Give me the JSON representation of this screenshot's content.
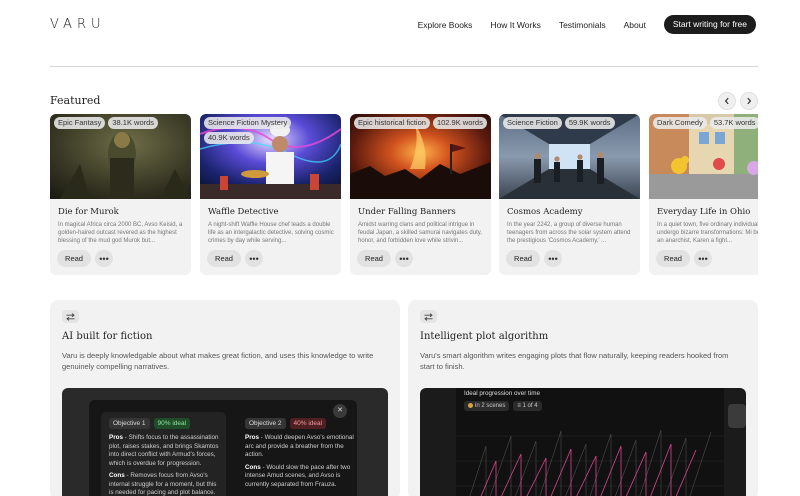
{
  "brand": {
    "logo": "VARU"
  },
  "nav": {
    "links": [
      "Explore Books",
      "How It Works",
      "Testimonials",
      "About"
    ],
    "cta": "Start writing for free"
  },
  "featured": {
    "title": "Featured",
    "read_label": "Read",
    "books": [
      {
        "title": "Die for Murok",
        "tags": [
          "Epic Fantasy",
          "38.1K words"
        ],
        "desc": "In magical Africa circa 2000 BC, Avso Keisid, a golden-haired outcast revered as the highest blessing of the mud god Murok but...",
        "cover": "fantasy-figure"
      },
      {
        "title": "Waffle Detective",
        "tags": [
          "Science Fiction Mystery",
          "40.9K words"
        ],
        "desc": "A night-shift Waffle House chef leads a double life as an intergalactic detective, solving cosmic crimes by day while serving...",
        "cover": "chef-neon"
      },
      {
        "title": "Under Falling Banners",
        "tags": [
          "Epic historical fiction",
          "102.9K words"
        ],
        "desc": "Amidst warring clans and political intrigue in feudal Japan, a skilled samurai navigates duty, honor, and forbidden love while strivin...",
        "cover": "fire-battle"
      },
      {
        "title": "Cosmos Academy",
        "tags": [
          "Science Fiction",
          "59.9K words"
        ],
        "desc": "In the year 2242, a group of diverse human teenagers from across the solar system attend the prestigious 'Cosmos Academy,' ...",
        "cover": "space-corridor"
      },
      {
        "title": "Everyday Life in Ohio",
        "tags": [
          "Dark Comedy",
          "53.7K words"
        ],
        "desc": "In a quiet town, five ordinary individuals undergo bizarre transformations: Mi becomes an anarchist, Karen a fight...",
        "cover": "toy-street"
      }
    ]
  },
  "features": [
    {
      "title": "AI built for fiction",
      "desc": "Varu is deeply knowledgable about what makes great fiction, and uses this knowledge to write genuinely compelling narratives.",
      "objectives": [
        {
          "label": "Objective 1",
          "score": "90% ideal",
          "pros_label": "Pros",
          "pros": " - Shifts focus to the assassination plot, raises stakes, and brings Skamtos into direct conflict with Armud's forces, which is overdue for progression.",
          "cons_label": "Cons",
          "cons": " - Removes focus from Avso's internal struggle for a moment, but this is needed for pacing and plot balance."
        },
        {
          "label": "Objective 2",
          "score": "40% ideal",
          "pros_label": "Pros",
          "pros": " - Would deepen Avso's emotional arc and provide a breather from the action.",
          "cons_label": "Cons",
          "cons": " - Would slow the pace after two intense Amud scenes, and Avso is currently separated from Frauza."
        }
      ],
      "close_glyph": "✕"
    },
    {
      "title": "Intelligent plot algorithm",
      "desc": "Varu's smart algorithm writes engaging plots that flow naturally, keeping readers hooked from start to finish.",
      "plot_title": "Ideal progression over time",
      "chip_1": "in 2 scenes",
      "chip_2": "1 of 4"
    }
  ],
  "colors": {
    "accent": "#1c1c1c",
    "good": "#8fe39f",
    "bad": "#f29a9e",
    "plot_line": "#d9468f"
  },
  "icons": {
    "prev": "chevron-left-icon",
    "next": "chevron-right-icon",
    "more": "ellipsis-icon",
    "feature": "swap-arrows-icon"
  }
}
